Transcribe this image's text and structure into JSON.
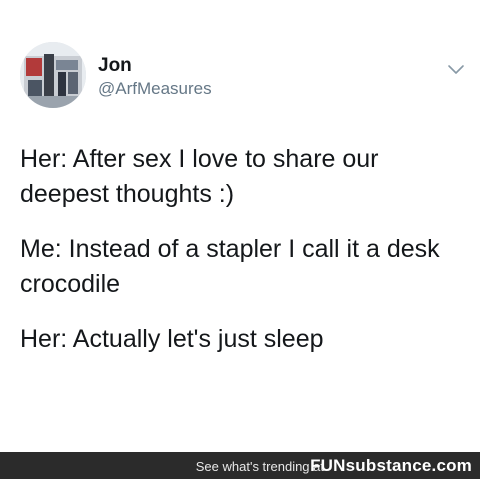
{
  "tweet": {
    "author": {
      "display_name": "Jon",
      "handle": "@ArfMeasures",
      "avatar_icon": "profile-photo"
    },
    "menu_icon": "chevron-down-icon",
    "paragraphs": [
      "Her: After sex I love to share our deepest thoughts :)",
      "Me: Instead of a stapler I call it a desk crocodile",
      "Her: Actually let's just sleep"
    ]
  },
  "footer": {
    "trending_text": "See what's trending at",
    "site_name": "FUNsubstance.com",
    "background_color": "#2b2b2b"
  }
}
